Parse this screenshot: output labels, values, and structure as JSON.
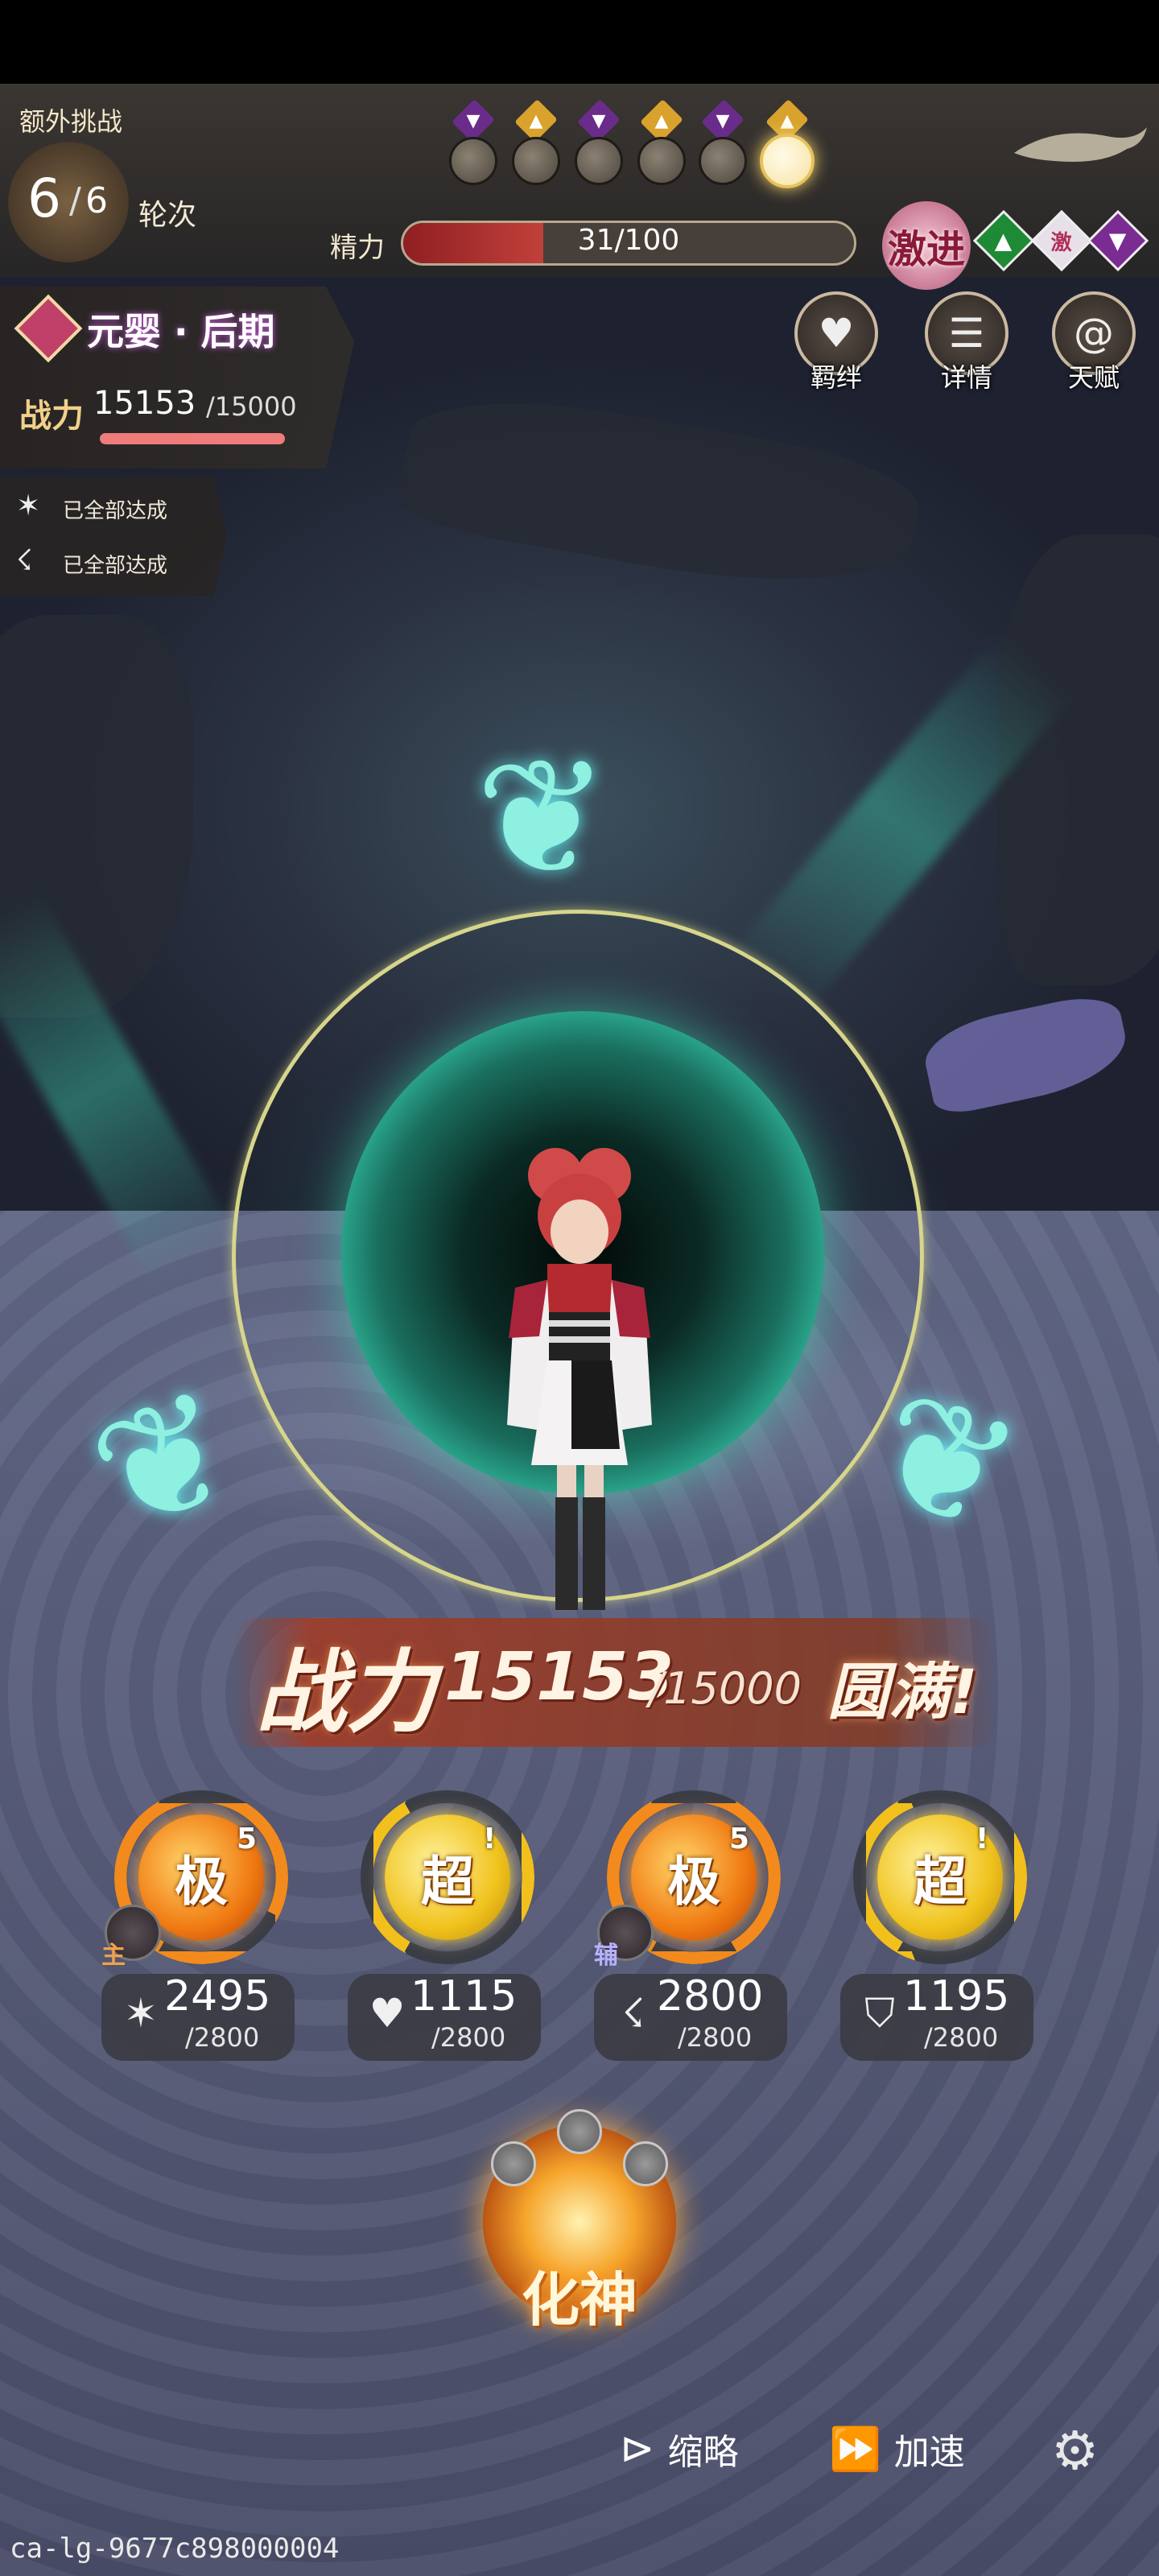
{
  "challenge": {
    "title": "额外挑战",
    "round_current": "6",
    "round_total": "6",
    "round_label": "轮次",
    "phases": [
      {
        "mark": "purple",
        "state": "done"
      },
      {
        "mark": "gold",
        "state": "done"
      },
      {
        "mark": "purple",
        "state": "done"
      },
      {
        "mark": "gold",
        "state": "done"
      },
      {
        "mark": "purple",
        "state": "done"
      },
      {
        "mark": "gold",
        "state": "active"
      }
    ]
  },
  "energy": {
    "label": "精力",
    "text": "31/100",
    "fraction": 0.31,
    "boost_label": "激进",
    "icons": [
      "arrow-up-icon",
      "激",
      "arrow-down-icon"
    ],
    "small_boost": "激"
  },
  "realm": {
    "name": "元婴 · 后期",
    "power_label": "战力",
    "power_value": "15153",
    "power_cap": "/15000"
  },
  "achievements": [
    {
      "icon": "claw-icon",
      "text": "已全部达成"
    },
    {
      "icon": "foot-icon",
      "text": "已全部达成"
    }
  ],
  "actions": {
    "bond": "羁绊",
    "detail": "详情",
    "talent": "天赋"
  },
  "banner": {
    "label": "战力",
    "value": "15153",
    "cap": "/15000",
    "status": "圆满!"
  },
  "stats": [
    {
      "grade": "极",
      "sup": "5",
      "role": "主",
      "icon": "claw-icon",
      "value": "2495",
      "cap": "/2800",
      "color": "orange",
      "fraction": 0.89
    },
    {
      "grade": "超",
      "sup": "!",
      "role": "",
      "icon": "heart-icon",
      "value": "1115",
      "cap": "/2800",
      "color": "yellow",
      "fraction": 0.4
    },
    {
      "grade": "极",
      "sup": "5",
      "role": "辅",
      "icon": "foot-icon",
      "value": "2800",
      "cap": "/2800",
      "color": "orange",
      "fraction": 1.0
    },
    {
      "grade": "超",
      "sup": "!",
      "role": "",
      "icon": "shield-icon",
      "value": "1195",
      "cap": "/2800",
      "color": "yellow",
      "fraction": 0.43
    }
  ],
  "transform_button": "化神",
  "controls": {
    "skip": "缩略",
    "speed": "加速"
  },
  "footer_id": "ca-lg-9677c898000004",
  "colors": {
    "energy_fill": "#c1403a",
    "gauge_orange": "#f28a1e",
    "gauge_yellow": "#f2c01c",
    "portal": "#2fb79a"
  }
}
